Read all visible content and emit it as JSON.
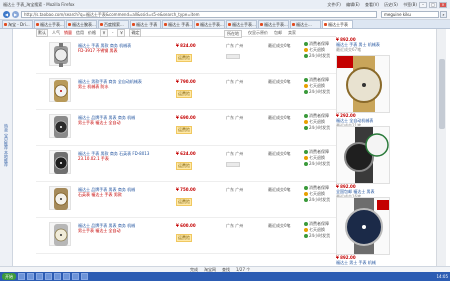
{
  "window": {
    "title": "福达士 手表_淘宝搜索 - Mozilla Firefox",
    "menus": [
      "文件(F)",
      "编辑(E)",
      "查看(V)",
      "历史(S)",
      "书签(B)"
    ]
  },
  "address": {
    "url": "http://s.taobao.com/search?q=福达士手表&commend=all&ssid=s5-e&search_type=item",
    "search_value": "meguine kiku"
  },
  "tabs": [
    "淘宝 - Dri...",
    "福达士手表...",
    "福达士腕表...",
    "百度搜索...",
    "福达士 手表",
    "福达士 手表...",
    "福达士手表...",
    "福达士手表...",
    "福达士手表...",
    "福达士...",
    "福达士手表"
  ],
  "sidebar_label": "热卖 宝贝推荐 本地推荐",
  "sortbar": {
    "items": [
      "默认",
      "人气",
      "销量",
      "信用",
      "价格",
      "￥",
      "-",
      "￥",
      "确定"
    ],
    "active_index": 2
  },
  "filters": {
    "location": "所在地",
    "only_original": "仅显示原价",
    "free_ship": "包邮",
    "seller": "卖家"
  },
  "rows": [
    {
      "title": "福达士 手表 男款 商务 机械表",
      "title2": "FD-3917 不锈钢 男表",
      "price": "¥ 824.00",
      "tag": "运费险",
      "loc": "广东 广州",
      "sales": "最近成交0笔",
      "svc": [
        "消费者保障",
        "七天退换",
        "24小时发货"
      ]
    },
    {
      "title": "福达士 男款手表 商务 全自动机械表",
      "title2": "男士 机械表 防水",
      "price": "¥ 790.00",
      "tag": "运费险",
      "loc": "广东 广州",
      "sales": "最近成交0笔",
      "svc": [
        "消费者保障",
        "七天退换",
        "24小时发货"
      ]
    },
    {
      "title": "福达士 品牌手表 男表 商务 机械",
      "title2": "男士手表 福达士 全自动",
      "price": "¥ 690.00",
      "tag": "运费险",
      "loc": "广东 广州",
      "sales": "最近成交0笔",
      "svc": [
        "消费者保障",
        "七天退换",
        "24小时发货"
      ]
    },
    {
      "title": "福达士 手表 男款 商务 石英表 FD-8013",
      "title2": "23.10.02.1 手表",
      "price": "¥ 624.00",
      "tag": "运费险",
      "loc": "广东 广州",
      "sales": "最近成交0笔",
      "svc": [
        "消费者保障",
        "七天退换",
        "24小时发货"
      ]
    },
    {
      "title": "福达士 品牌手表 男表 商务 机械",
      "title2": "石英表 福达士 手表 男款",
      "price": "¥ 750.00",
      "tag": "运费险",
      "loc": "广东 广州",
      "sales": "最近成交0笔",
      "svc": [
        "消费者保障",
        "七天退换",
        "24小时发货"
      ]
    },
    {
      "title": "福达士 品牌手表 男表 商务 机械",
      "title2": "男士手表 福达士 全自动",
      "price": "¥ 600.00",
      "tag": "运费险",
      "loc": "广东 广州",
      "sales": "最近成交0笔",
      "svc": [
        "消费者保障",
        "七天退换",
        "24小时发货"
      ]
    }
  ],
  "ads": [
    {
      "price": "¥ 892.00",
      "line1": "福达士 手表 男士 机械表",
      "line2": "最近成交67笔",
      "badge": ""
    },
    {
      "price": "¥ 292.00",
      "line1": "福达士 全自动机械表",
      "line2": "最近成交21笔",
      "badge": "292"
    },
    {
      "price": "¥ 892.00",
      "line1": "全国包邮 福达士 男表",
      "line2": "最近成交16笔",
      "badge": "全国包邮"
    },
    {
      "price": "¥ 892.00",
      "line1": "福达士 男士 手表 机械",
      "line2": "最近成交36笔",
      "badge": "430元"
    }
  ],
  "status": {
    "items": [
      "完成",
      "淘宝网",
      "查找",
      "1/27 个"
    ]
  },
  "taskbar": {
    "start": "开始",
    "clock": "14:05"
  }
}
